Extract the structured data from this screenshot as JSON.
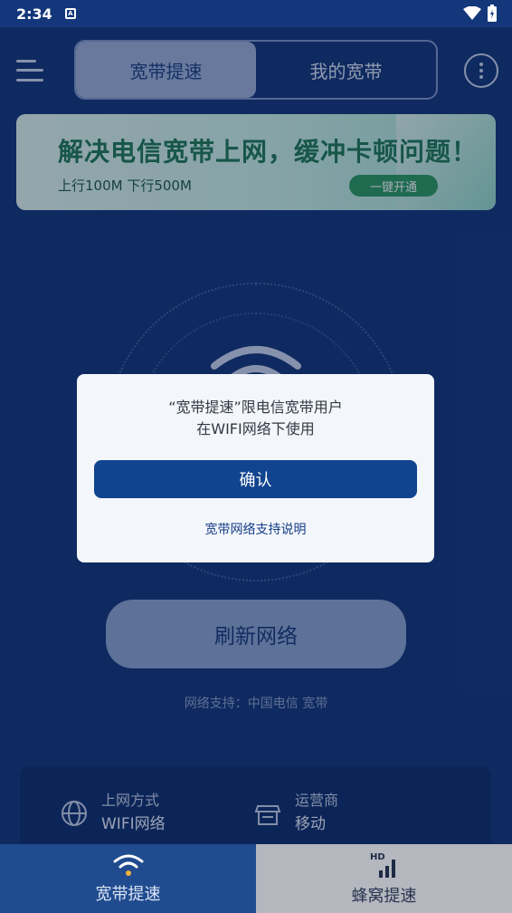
{
  "status_bar": {
    "time": "2:34",
    "notif_badge": "A"
  },
  "header": {
    "tabs": [
      {
        "label": "宽带提速",
        "active": true
      },
      {
        "label": "我的宽带",
        "active": false
      }
    ]
  },
  "banner": {
    "title": "解决电信宽带上网，缓冲卡顿问题！",
    "subtitle": "上行100M 下行500M",
    "cta": "一键开通"
  },
  "dialog": {
    "line1": "“宽带提速”限电信宽带用户",
    "line2": "在WIFI网络下使用",
    "confirm": "确认",
    "link": "宽带网络支持说明"
  },
  "refresh_label": "刷新网络",
  "support_text": "网络支持：中国电信 宽带",
  "info": {
    "access": {
      "label": "上网方式",
      "value": "WIFI网络",
      "icon": "globe-icon"
    },
    "carrier": {
      "label": "运营商",
      "value": "移动",
      "icon": "store-icon"
    }
  },
  "bottom_nav": [
    {
      "label": "宽带提速",
      "icon": "wifi-icon",
      "active": true
    },
    {
      "label": "蜂窝提速",
      "icon": "hd-signal-icon",
      "active": false
    }
  ],
  "colors": {
    "background": "#13377a",
    "accent": "#11448f",
    "banner_green": "#1f7a56"
  }
}
